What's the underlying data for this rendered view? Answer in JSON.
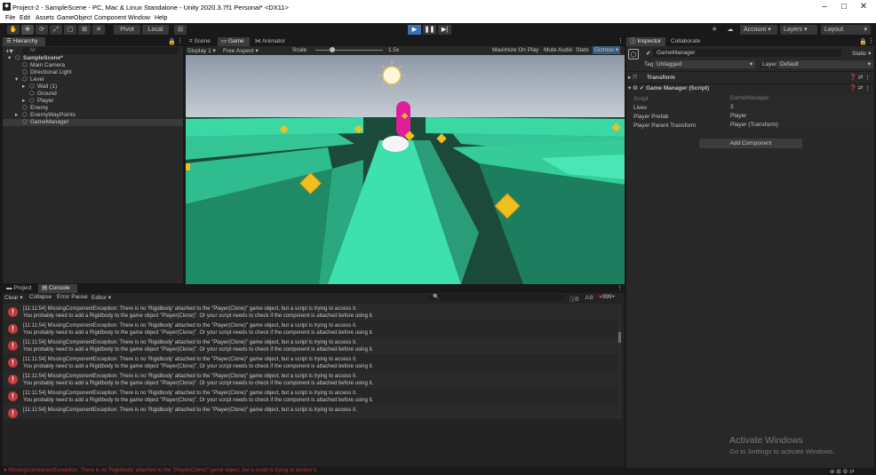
{
  "window": {
    "title": "Project-2 - SampleScene - PC, Mac & Linux Standalone - Unity 2020.3.7f1 Personal* <DX11>",
    "controls": [
      "–",
      "□",
      "✕"
    ]
  },
  "menu": [
    "File",
    "Edit",
    "Assets",
    "GameObject",
    "Component",
    "Window",
    "Help"
  ],
  "toolbar": {
    "pivot_label": "Pivot",
    "local_label": "Local",
    "account_label": "Account",
    "layers_label": "Layers",
    "layout_label": "Layout"
  },
  "hierarchy": {
    "tab_label": "Hierarchy",
    "search_placeholder": "All",
    "items": [
      {
        "label": "SampleScene*",
        "depth": 0,
        "arrow": "▾",
        "icon": "scene-icon"
      },
      {
        "label": "Main Camera",
        "depth": 1,
        "arrow": "",
        "icon": "gameobject-icon"
      },
      {
        "label": "Directional Light",
        "depth": 1,
        "arrow": "",
        "icon": "gameobject-icon"
      },
      {
        "label": "Level",
        "depth": 1,
        "arrow": "▾",
        "icon": "gameobject-icon"
      },
      {
        "label": "Wall (1)",
        "depth": 2,
        "arrow": "▸",
        "icon": "gameobject-icon"
      },
      {
        "label": "Ground",
        "depth": 2,
        "arrow": "",
        "icon": "gameobject-icon"
      },
      {
        "label": "Player",
        "depth": 2,
        "arrow": "▸",
        "icon": "gameobject-icon"
      },
      {
        "label": "Enemy",
        "depth": 1,
        "arrow": "",
        "icon": "gameobject-icon"
      },
      {
        "label": "EnemyWayPoints",
        "depth": 1,
        "arrow": "▸",
        "icon": "gameobject-icon"
      },
      {
        "label": "GameManager",
        "depth": 1,
        "arrow": "",
        "icon": "gameobject-icon"
      }
    ]
  },
  "gameview": {
    "tabs": [
      "Scene",
      "Game",
      "Animator"
    ],
    "display_label": "Display 1",
    "aspect_label": "Free Aspect",
    "scale_label": "Scale",
    "scale_value": "1.5x",
    "right_options": [
      "Maximize On Play",
      "Mute Audio",
      "Stats",
      "Gizmos"
    ]
  },
  "inspector": {
    "tabs": [
      "Inspector",
      "Collaborate"
    ],
    "object_name": "GameManager",
    "static_label": "Static",
    "tag_label": "Tag",
    "tag_value": "Untagged",
    "layer_label": "Layer",
    "layer_value": "Default",
    "transform_label": "Transform",
    "component_label": "Game Manager (Script)",
    "fields": [
      {
        "label": "Script",
        "value": "GameManager"
      },
      {
        "label": "Lives",
        "value": "3"
      },
      {
        "label": "Player Prefab",
        "value": "Player"
      },
      {
        "label": "Player Parent Transform",
        "value": "Player (Transform)"
      }
    ],
    "add_component_label": "Add Component"
  },
  "console": {
    "tabs": [
      "Project",
      "Console"
    ],
    "toolbar": [
      "Clear",
      "Collapse",
      "Error Pause",
      "Editor"
    ],
    "counts": {
      "info": "0",
      "warn": "0",
      "error": "999+"
    },
    "line1": "[11:11:54] MissingComponentException: There is no 'Rigidbody' attached to the \"Player(Clone)\" game object, but a script is trying to access it.",
    "line2": "You probably need to add a Rigidbody to the game object \"Player(Clone)\". Or your script needs to check if the component is attached before using it.",
    "status_line": "MissingComponentException: There is no 'Rigidbody' attached to the \"Player(Clone)\" game object, but a script is trying to access it."
  },
  "activate": {
    "title": "Activate Windows",
    "subtitle": "Go to Settings to activate Windows."
  }
}
